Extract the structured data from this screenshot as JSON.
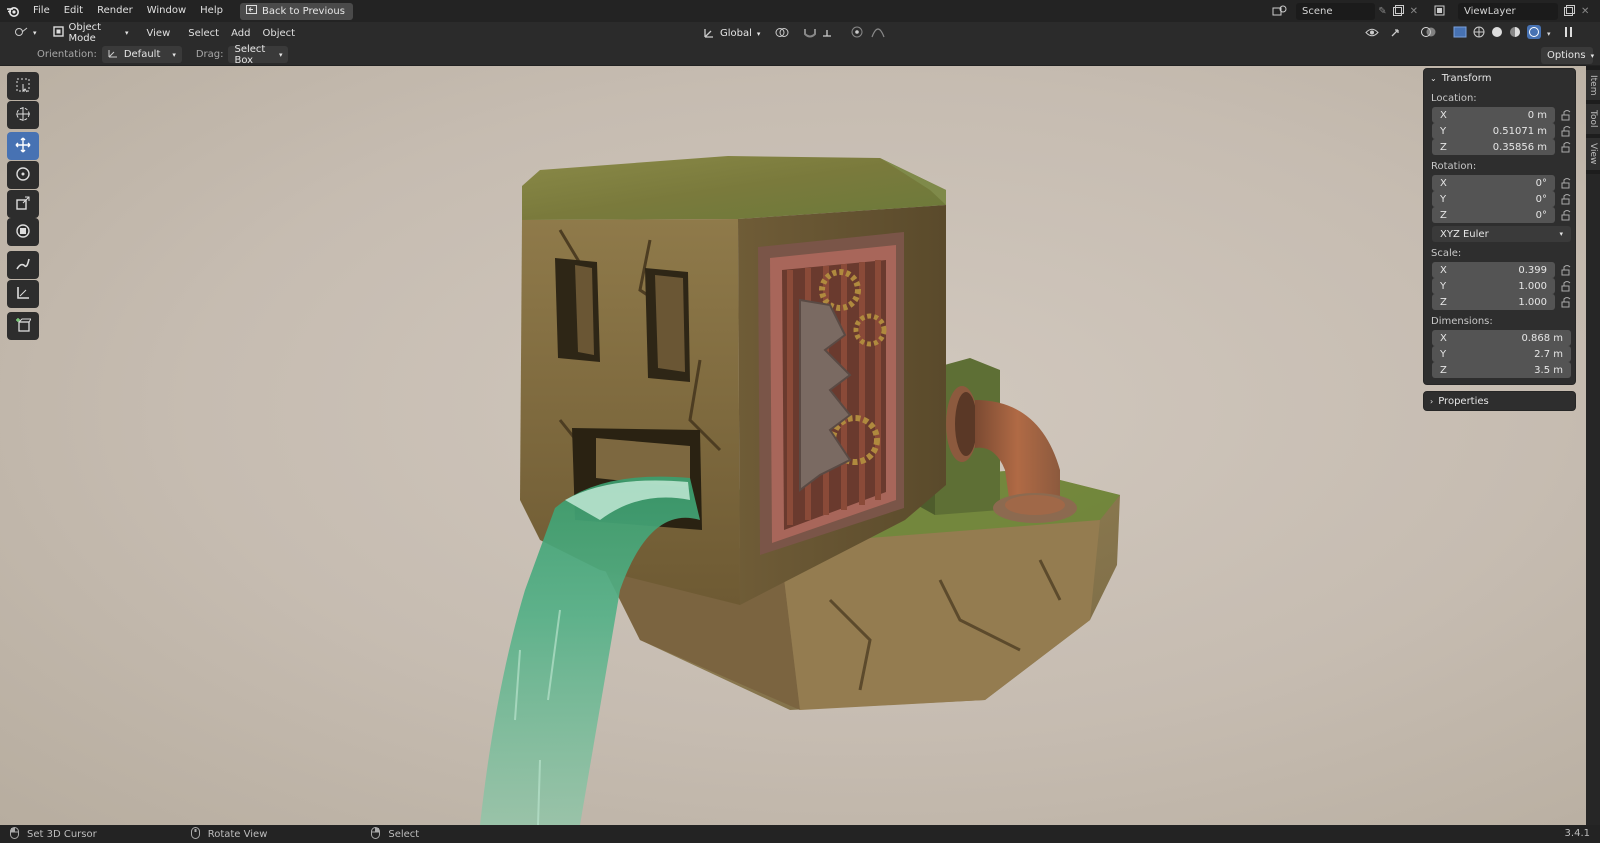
{
  "menu": {
    "file": "File",
    "edit": "Edit",
    "render": "Render",
    "window": "Window",
    "help": "Help"
  },
  "back_button": "Back to Previous",
  "scene_name": "Scene",
  "view_layer_name": "ViewLayer",
  "header": {
    "mode": "Object Mode",
    "view": "View",
    "select": "Select",
    "add": "Add",
    "object": "Object",
    "transform_orientation": "Global"
  },
  "tool_settings": {
    "orientation_label": "Orientation:",
    "orientation_value": "Default",
    "drag_label": "Drag:",
    "drag_value": "Select Box",
    "options": "Options"
  },
  "toolbar": {
    "tools": [
      "select-box",
      "cursor",
      "move",
      "rotate",
      "scale",
      "transform",
      "annotate",
      "measure",
      "add-cube"
    ],
    "active": "move"
  },
  "npanel": {
    "transform_title": "Transform",
    "location_label": "Location:",
    "location": {
      "x": "0 m",
      "y": "0.51071 m",
      "z": "0.35856 m"
    },
    "rotation_label": "Rotation:",
    "rotation": {
      "x": "0°",
      "y": "0°",
      "z": "0°"
    },
    "rotation_mode": "XYZ Euler",
    "scale_label": "Scale:",
    "scale": {
      "x": "0.399",
      "y": "1.000",
      "z": "1.000"
    },
    "dimensions_label": "Dimensions:",
    "dimensions": {
      "x": "0.868 m",
      "y": "2.7 m",
      "z": "3.5 m"
    },
    "axis": {
      "x": "X",
      "y": "Y",
      "z": "Z"
    },
    "properties_title": "Properties"
  },
  "side_tabs": {
    "item": "Item",
    "tool": "Tool",
    "view": "View"
  },
  "status": {
    "left_click": "Set 3D Cursor",
    "middle_click": "Rotate View",
    "right_click": "Select",
    "version": "3.4.1"
  },
  "colors": {
    "accent": "#4772b3",
    "viewport_bg": "#c9c0b5",
    "water": "#3fae7e",
    "stone": "#8f7448",
    "moss": "#5f8a34",
    "pipe": "#a05a38"
  }
}
